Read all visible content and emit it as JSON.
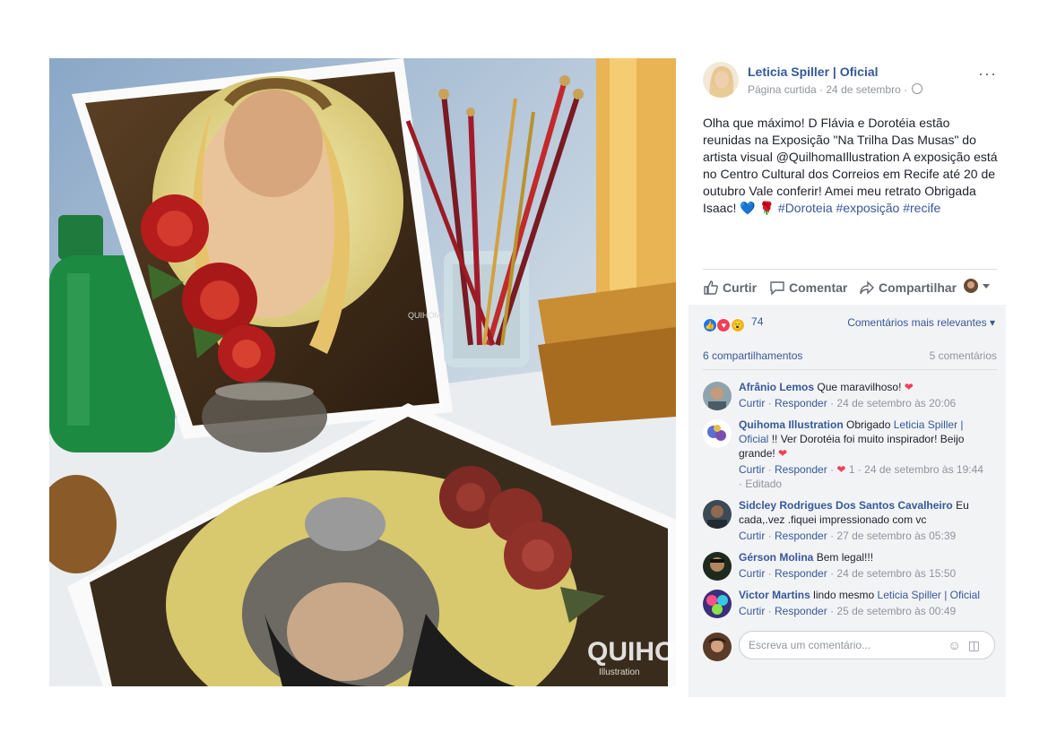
{
  "post": {
    "page_name": "Leticia Spiller | Oficial",
    "meta_text": "Página curtida · 24 de setembro ·",
    "more_label": "···",
    "text_main": "Olha que máximo! D Flávia e Dorotéia estão reunidas na Exposição \"Na Trilha Das Musas\" do artista visual @QuilhomaIllustration A exposição está no Centro Cultural dos Correios em Recife até 20 de outubro Vale conferir! Amei meu retrato Obrigada Isaac!",
    "emoji_heart": "💙",
    "emoji_rose": "🌹",
    "hashtags": [
      "#Doroteia",
      "#exposição",
      "#recife"
    ]
  },
  "photo": {
    "watermark_small": "QUIHOMA",
    "watermark_large": "QUIHOMA",
    "watermark_sub": "Illustration"
  },
  "actions": {
    "like_label": "Curtir",
    "comment_label": "Comentar",
    "share_label": "Compartilhar"
  },
  "stats": {
    "reaction_count": "74",
    "sort_label": "Comentários mais relevantes",
    "shares_label": "6 compartilhamentos",
    "comments_label": "5 comentários"
  },
  "comments": [
    {
      "author": "Afrânio Lemos",
      "text": "Que maravilhoso!",
      "like": "Curtir",
      "reply": "Responder",
      "time": "24 de setembro às 20:06"
    },
    {
      "author": "Quihoma Illustration",
      "text_before": "Obrigado",
      "mention": "Leticia Spiller | Oficial",
      "text_after": "!! Ver Dorotéia foi muito inspirador! Beijo grande!",
      "like": "Curtir",
      "reply": "Responder",
      "reaction_count": "1",
      "time": "24 de setembro às 19:44",
      "edited": "Editado"
    },
    {
      "author": "Sidcley Rodrigues Dos Santos Cavalheiro",
      "text": "Eu cada,.vez .fiquei impressionado com vc",
      "like": "Curtir",
      "reply": "Responder",
      "time": "27 de setembro às 05:39"
    },
    {
      "author": "Gérson Molina",
      "text": "Bem legal!!!",
      "like": "Curtir",
      "reply": "Responder",
      "time": "24 de setembro às 15:50"
    },
    {
      "author": "Victor Martins",
      "text": "lindo mesmo",
      "mention": "Leticia Spiller | Oficial",
      "like": "Curtir",
      "reply": "Responder",
      "time": "25 de setembro às 00:49"
    }
  ],
  "composer": {
    "placeholder": "Escreva um comentário..."
  },
  "colors": {
    "link": "#365899",
    "muted": "#90949c",
    "panel_bg": "#f2f3f5",
    "love": "#f33e58",
    "like": "#1877f2"
  }
}
